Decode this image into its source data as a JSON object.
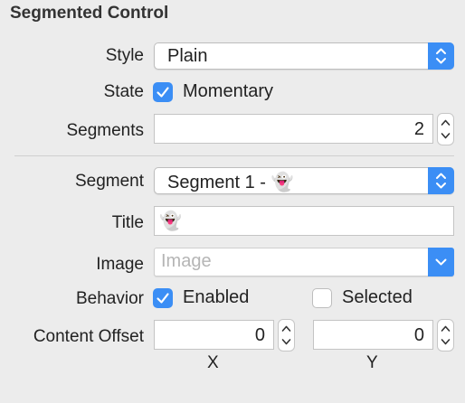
{
  "panel": {
    "title": "Segmented Control",
    "style": {
      "label": "Style",
      "value": "Plain"
    },
    "state": {
      "label": "State",
      "checkbox_label": "Momentary",
      "checked": true
    },
    "segments": {
      "label": "Segments",
      "value": "2"
    },
    "segment": {
      "label": "Segment",
      "value": "Segment 1 - 👻"
    },
    "title_field": {
      "label": "Title",
      "value": "👻"
    },
    "image": {
      "label": "Image",
      "placeholder": "Image"
    },
    "behavior": {
      "label": "Behavior",
      "enabled": {
        "label": "Enabled",
        "checked": true
      },
      "selected": {
        "label": "Selected",
        "checked": false
      }
    },
    "content_offset": {
      "label": "Content Offset",
      "x": {
        "value": "0",
        "caption": "X"
      },
      "y": {
        "value": "0",
        "caption": "Y"
      }
    }
  },
  "colors": {
    "accent": "#3b8ef5",
    "background": "#ececec"
  },
  "icons": {
    "popup_arrows": "up-down-chevrons-icon",
    "dropdown_arrow": "chevron-down-icon",
    "checkmark": "checkmark-icon",
    "stepper": "stepper-arrows-icon"
  }
}
